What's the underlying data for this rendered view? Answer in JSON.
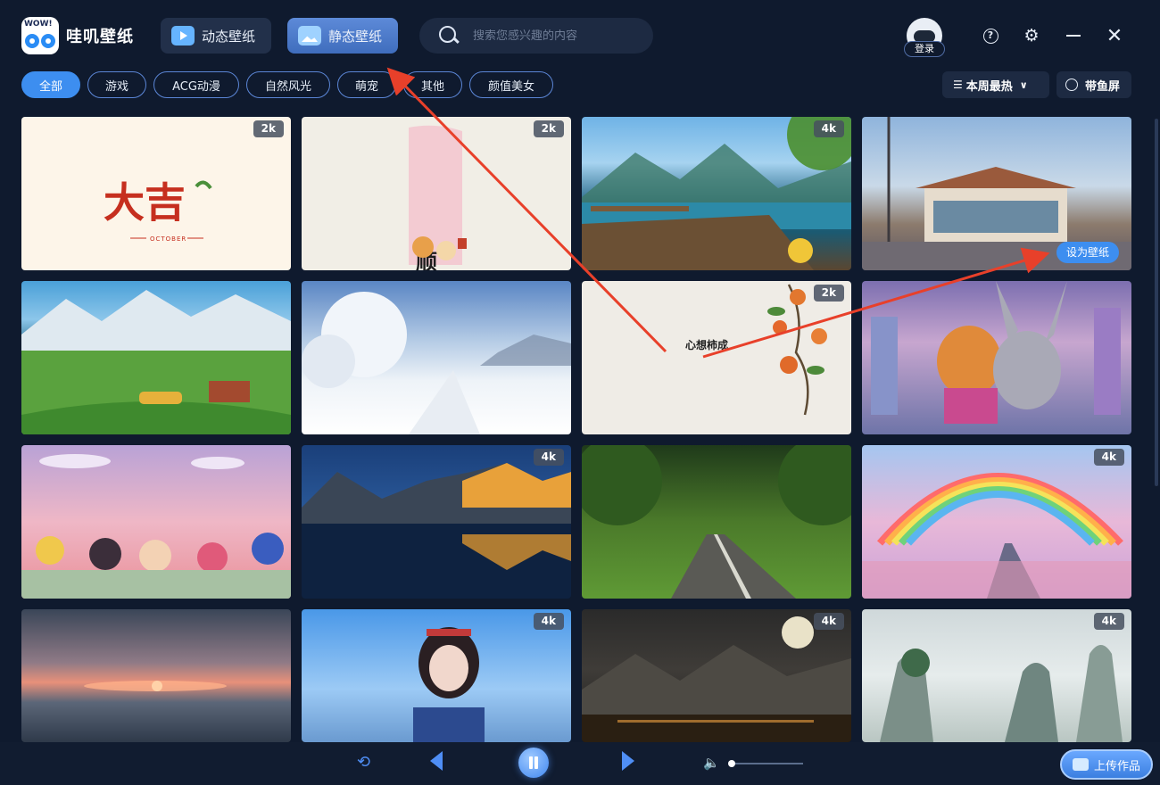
{
  "app": {
    "logo_text": "WOW!",
    "title": "哇叽壁纸"
  },
  "tabs": [
    {
      "label": "动态壁纸"
    },
    {
      "label": "静态壁纸"
    }
  ],
  "search": {
    "placeholder": "搜索您感兴趣的内容"
  },
  "user": {
    "login_label": "登录"
  },
  "window": {
    "help_icon": "?",
    "settings_icon": "⚙",
    "close_icon": "✕"
  },
  "categories": [
    {
      "label": "全部"
    },
    {
      "label": "游戏"
    },
    {
      "label": "ACG动漫"
    },
    {
      "label": "自然风光"
    },
    {
      "label": "萌宠"
    },
    {
      "label": "其他"
    },
    {
      "label": "颜值美女"
    }
  ],
  "sort": {
    "icon": "☰",
    "label": "本周最热",
    "chevron": "∨"
  },
  "fish_screen": {
    "label": "带鱼屏"
  },
  "wallpapers": [
    {
      "name": "daji-october",
      "res": "2k",
      "text": "大吉",
      "subtext": "OCTOBER"
    },
    {
      "name": "shun-caishen",
      "res": "2k",
      "text": "顺财神"
    },
    {
      "name": "lake-deck",
      "res": "4k"
    },
    {
      "name": "anime-store",
      "res": "",
      "hover_button": "设为壁纸"
    },
    {
      "name": "mountain-farm",
      "res": ""
    },
    {
      "name": "snow-forest",
      "res": ""
    },
    {
      "name": "persimmon-wish",
      "res": "2k",
      "text": "心想柿成"
    },
    {
      "name": "zootopia",
      "res": ""
    },
    {
      "name": "crayon-shin",
      "res": ""
    },
    {
      "name": "mountain-reflection",
      "res": "4k"
    },
    {
      "name": "forest-road",
      "res": ""
    },
    {
      "name": "rainbow-road",
      "res": "4k"
    },
    {
      "name": "sunset-sea",
      "res": ""
    },
    {
      "name": "ethnic-girl",
      "res": "4k"
    },
    {
      "name": "moon-night-town",
      "res": "4k"
    },
    {
      "name": "misty-karst",
      "res": "4k"
    }
  ],
  "player": {
    "loop_icon": "⟲",
    "volume_icon": "🔈",
    "volume": 0.0
  },
  "upload": {
    "label": "上传作品"
  },
  "colors": {
    "accent": "#3d8ef0",
    "background": "#0f1a2e",
    "annotation_arrow": "#e8402a"
  }
}
